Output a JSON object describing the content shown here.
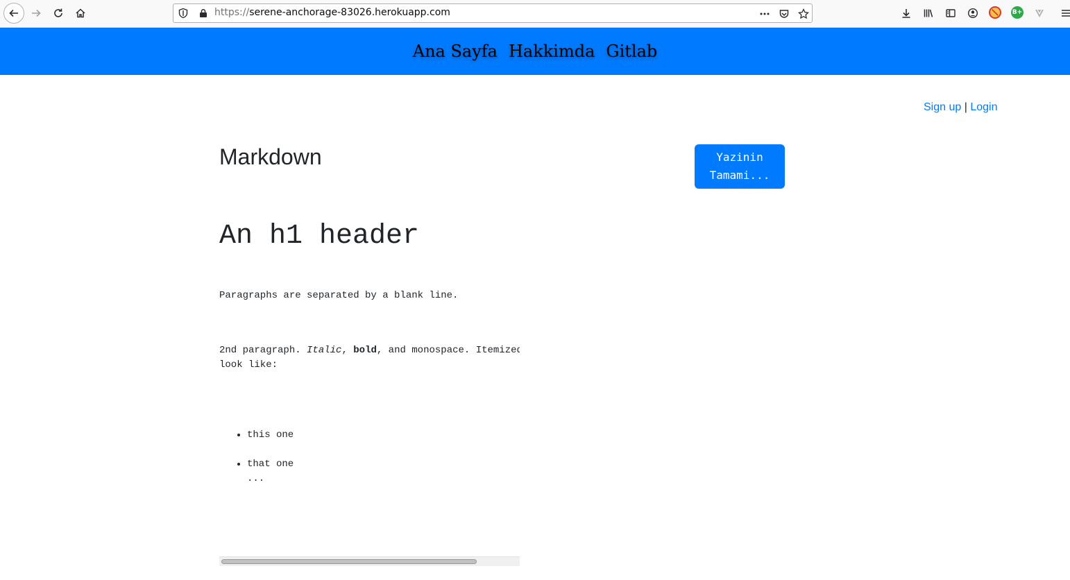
{
  "browser": {
    "url_scheme": "https://",
    "url_host": "serene-anchorage-83026.herokuapp.com",
    "icons": [
      "back-icon",
      "forward-icon",
      "reload-icon",
      "home-icon",
      "shield-icon",
      "lock-icon",
      "more-actions-icon",
      "pocket-icon",
      "bookmark-star-icon",
      "downloads-icon",
      "library-icon",
      "sidebar-icon",
      "account-icon",
      "extension-blocker-icon",
      "extension-badge-icon",
      "extension-v-icon",
      "menu-icon"
    ],
    "extension_badge_text": "B+",
    "colors": {
      "toolbar": "#f9f9fa",
      "extension_badge": "#2ea84a",
      "extension_blocker": "#e0372d"
    }
  },
  "nav": {
    "items": [
      {
        "label": "Ana Sayfa"
      },
      {
        "label": "Hakkimda"
      },
      {
        "label": "Gitlab"
      }
    ],
    "color": "#007bff"
  },
  "auth": {
    "signup": "Sign up",
    "separator": "|",
    "login": "Login"
  },
  "post": {
    "title": "Markdown",
    "read_more_line1": "Yazinin",
    "read_more_line2": "Tamami...",
    "content": {
      "h1": "An h1 header",
      "p1": "Paragraphs are separated by a blank line.",
      "p2_start": "2nd paragraph. ",
      "p2_italic": "Italic",
      "p2_sep": ", ",
      "p2_bold": "bold",
      "p2_rest": ", and monospace. Itemized",
      "p2_line2": "look like:",
      "list": [
        "this one",
        "that one"
      ],
      "list_continuation": "..."
    }
  }
}
